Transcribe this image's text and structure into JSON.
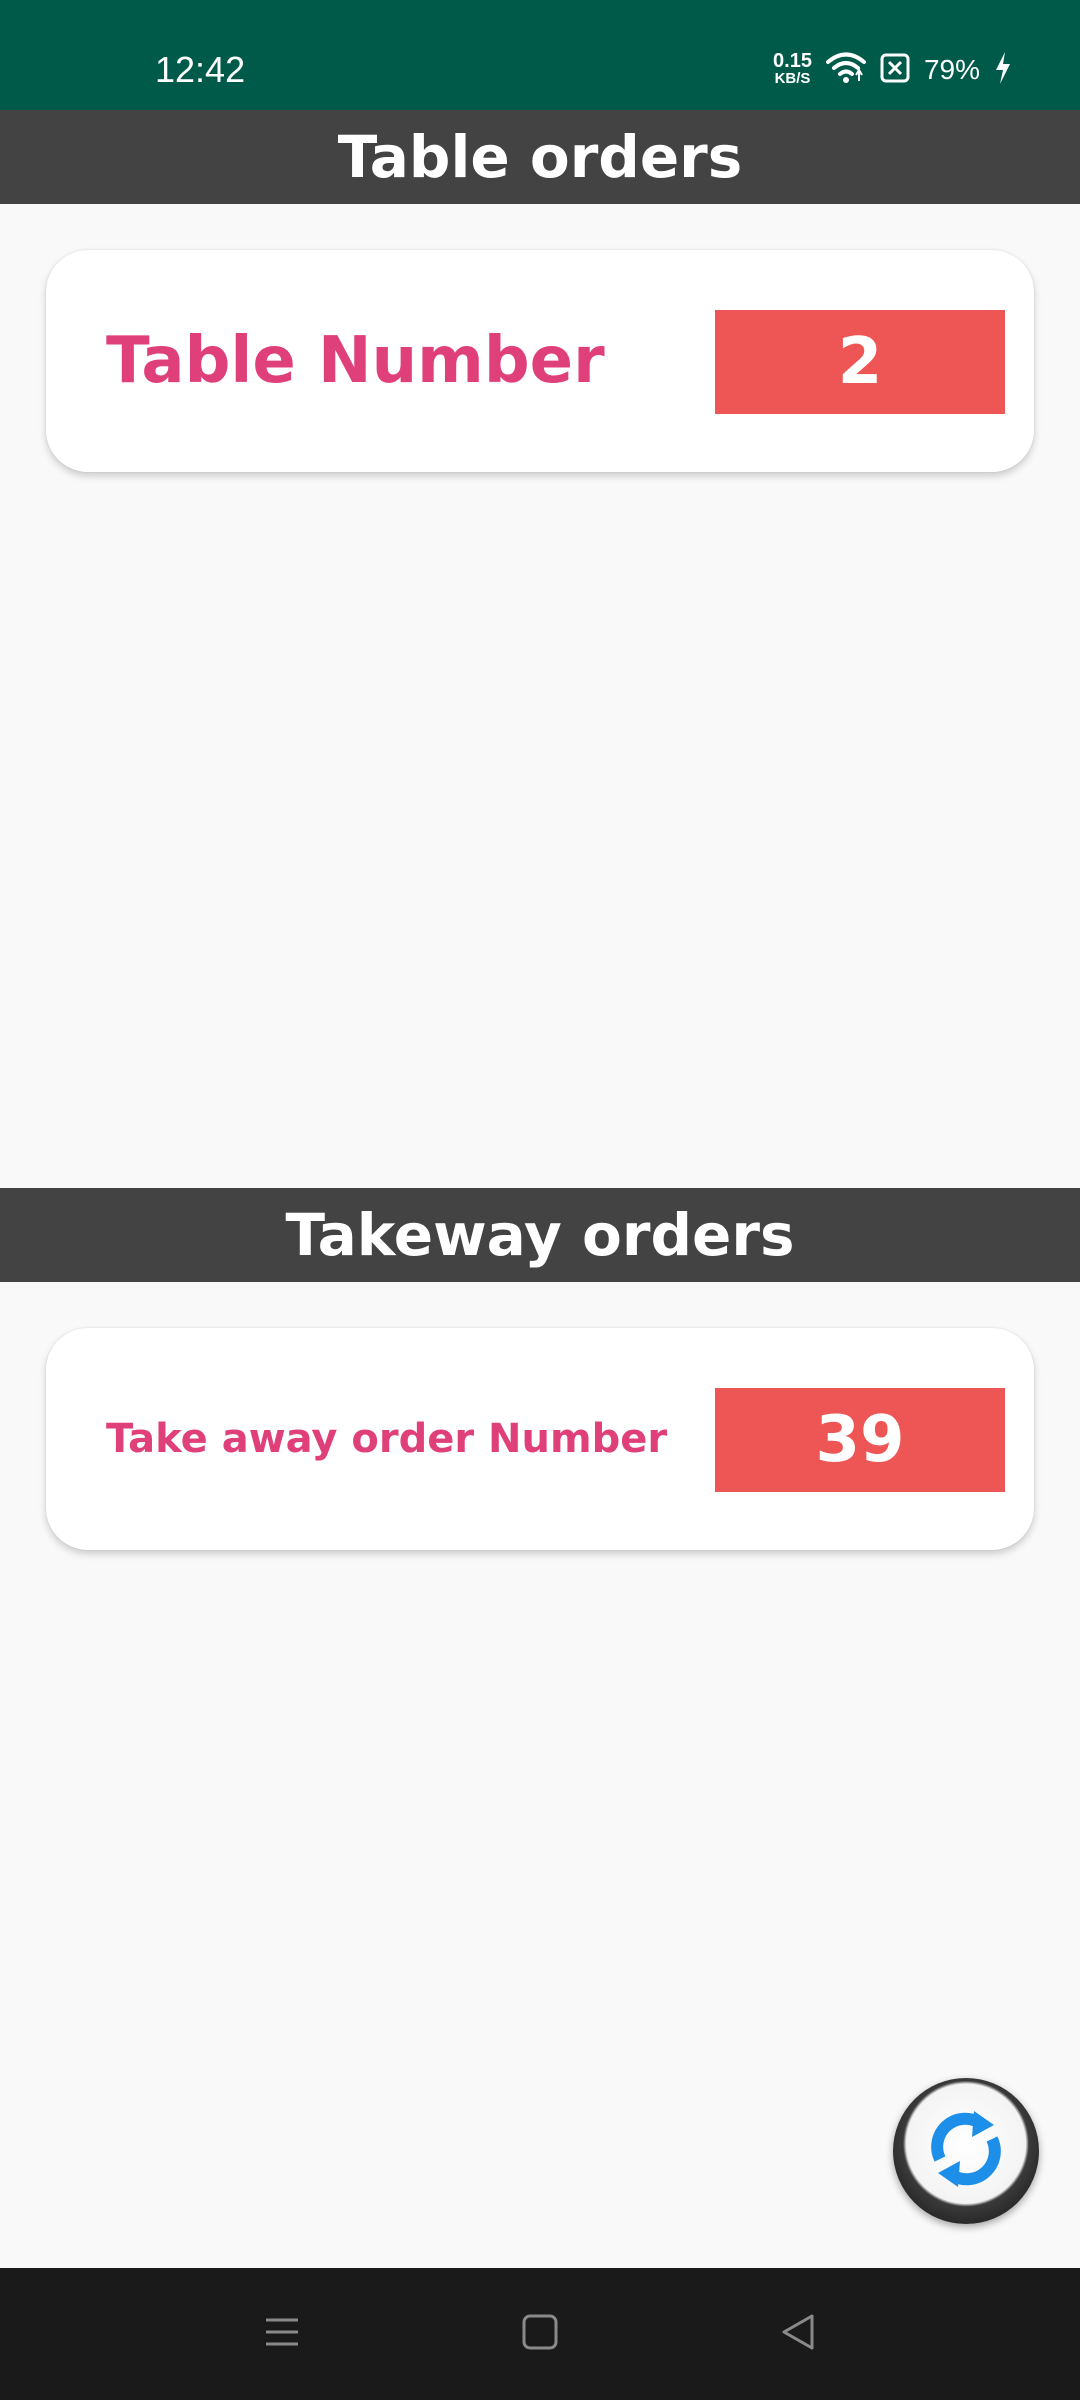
{
  "status_bar": {
    "time": "12:42",
    "net_speed_value": "0.15",
    "net_speed_unit": "KB/S",
    "battery": "79%",
    "icons": [
      "wifi-icon",
      "no-sim-icon",
      "charging-icon"
    ]
  },
  "table_section": {
    "header": "Table orders",
    "card": {
      "label": "Table Number",
      "value": "2"
    }
  },
  "takeaway_section": {
    "header": "Takeway orders",
    "card": {
      "label": "Take away order Number",
      "value": "39"
    }
  },
  "fab": {
    "icon": "refresh-icon"
  },
  "nav_bar": {
    "buttons": [
      "menu-icon",
      "home-icon",
      "back-icon"
    ]
  },
  "colors": {
    "status_bar": "#005a4a",
    "header_bg": "#434343",
    "label_pink": "#e0407a",
    "value_red": "#ee5555",
    "nav_bar": "#1a1a1a"
  }
}
